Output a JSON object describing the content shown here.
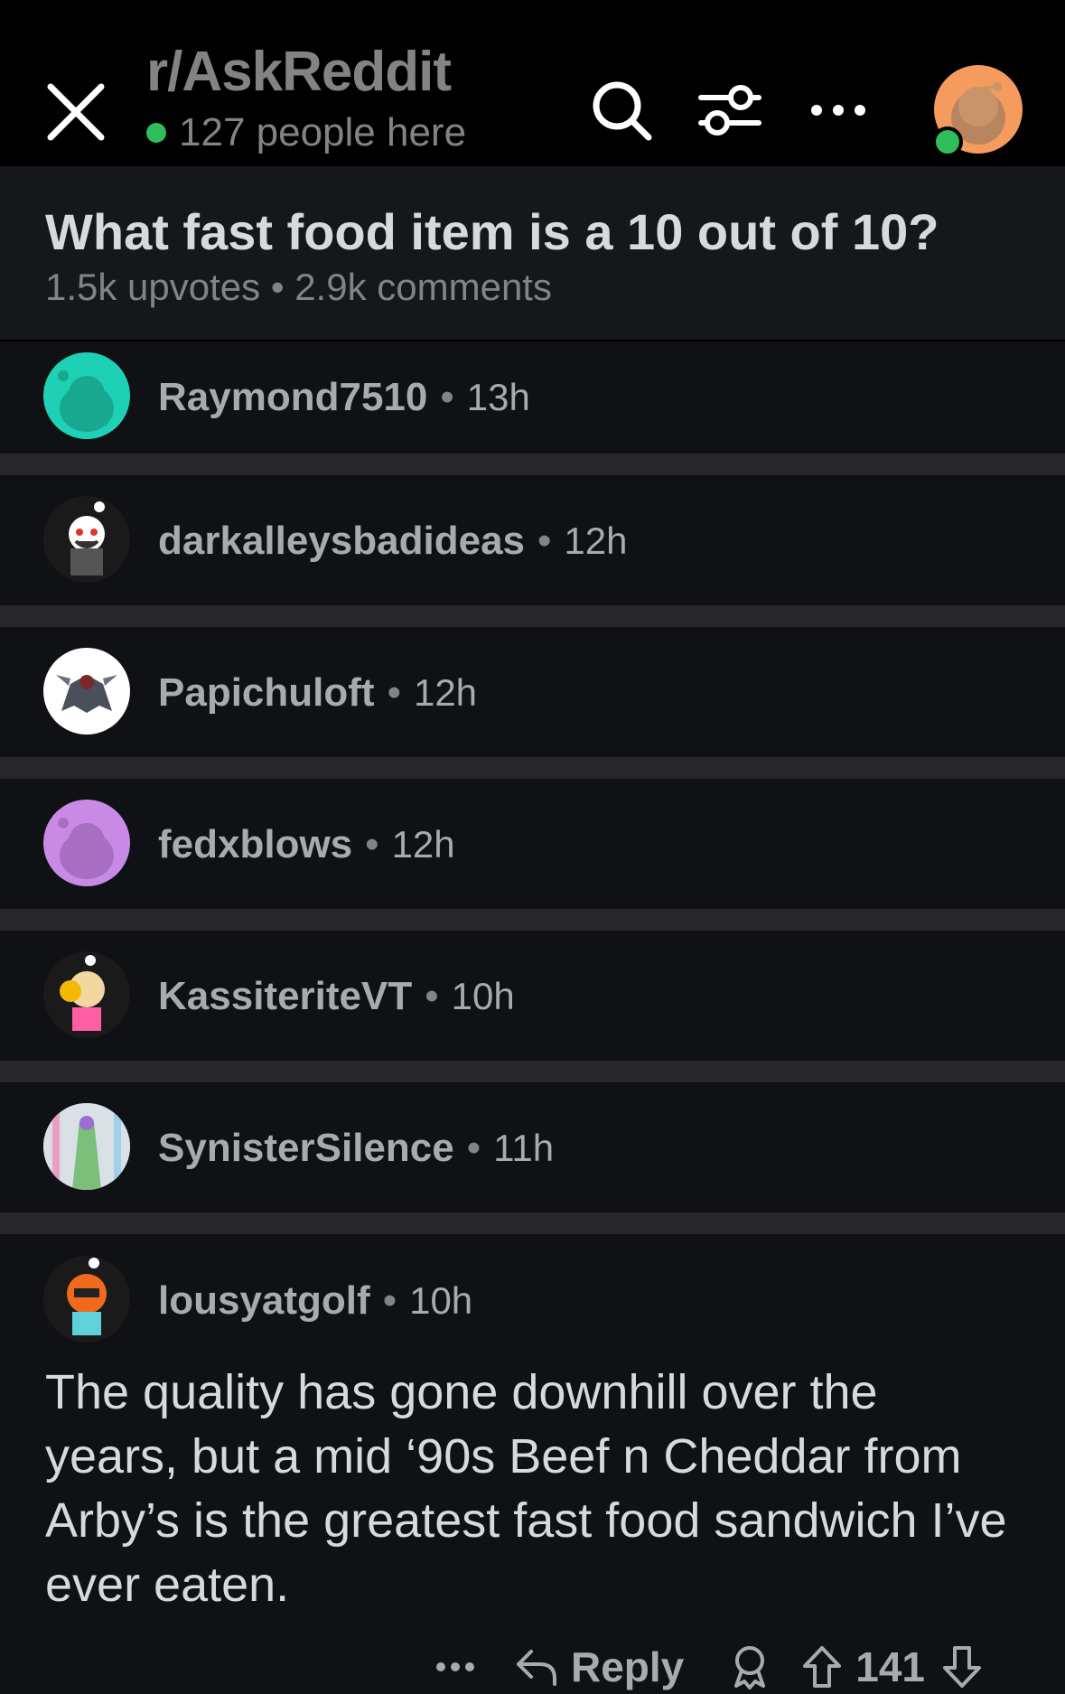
{
  "header": {
    "subreddit": "r/AskReddit",
    "online_text": "127 people here",
    "icons": [
      "close-icon",
      "search-icon",
      "filter-icon",
      "more-icon",
      "user-avatar"
    ],
    "colors": {
      "online": "#2ebd59",
      "avatar_bg": "#f59b5e"
    }
  },
  "post": {
    "title": "What fast food item is a 10 out of 10?",
    "meta": "1.5k upvotes • 2.9k comments"
  },
  "comments": [
    {
      "user": "Raymond7510",
      "time": "13h",
      "avatar_color": "#1fd1b4"
    },
    {
      "user": "darkalleysbadideas",
      "time": "12h",
      "avatar_color": "#1a1a1b"
    },
    {
      "user": "Papichuloft",
      "time": "12h",
      "avatar_color": "#ffffff"
    },
    {
      "user": "fedxblows",
      "time": "12h",
      "avatar_color": "#c98ae6"
    },
    {
      "user": "KassiteriteVT",
      "time": "10h",
      "avatar_color": "#1a1a1b"
    },
    {
      "user": "SynisterSilence",
      "time": "11h",
      "avatar_color": "#cfcfcf"
    },
    {
      "user": "lousyatgolf",
      "time": "10h",
      "avatar_color": "#1a1a1b"
    }
  ],
  "expanded_comment": {
    "body": "The quality has gone downhill over the years, but a mid ‘90s Beef n Cheddar from Arby’s is the greatest fast food sandwich I’ve ever eaten.",
    "reply_label": "Reply",
    "score": "141"
  }
}
